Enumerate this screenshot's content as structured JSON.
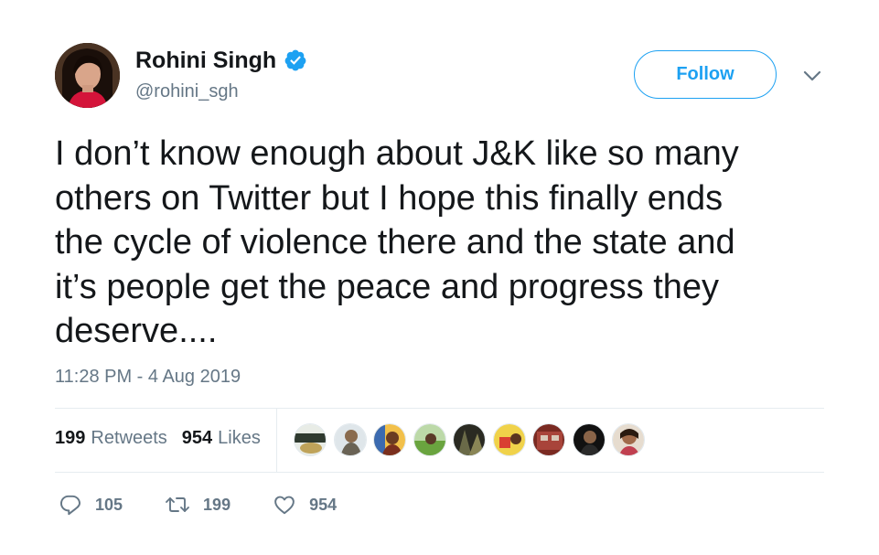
{
  "user": {
    "name": "Rohini Singh",
    "handle": "@rohini_sgh",
    "verified": true
  },
  "follow": {
    "label": "Follow"
  },
  "tweet": {
    "text": "I don’t know enough about J&K like so many\nothers on Twitter but I hope this finally ends\nthe cycle of violence there and the state and\nit’s people get the peace and progress they\ndeserve....",
    "timestamp": "11:28 PM - 4 Aug 2019"
  },
  "stats": {
    "retweets_count": "199",
    "retweets_label": "Retweets",
    "likes_count": "954",
    "likes_label": "Likes"
  },
  "likers": [
    {
      "icon": "liker-avatar"
    },
    {
      "icon": "liker-avatar"
    },
    {
      "icon": "liker-avatar"
    },
    {
      "icon": "liker-avatar"
    },
    {
      "icon": "liker-avatar"
    },
    {
      "icon": "liker-avatar"
    },
    {
      "icon": "liker-avatar"
    },
    {
      "icon": "liker-avatar"
    },
    {
      "icon": "liker-avatar"
    }
  ],
  "actions": {
    "reply_count": "105",
    "retweet_count": "199",
    "like_count": "954"
  },
  "colors": {
    "accent": "#1da1f2",
    "text": "#14171a",
    "muted": "#657786",
    "divider": "#e6ecf0"
  }
}
